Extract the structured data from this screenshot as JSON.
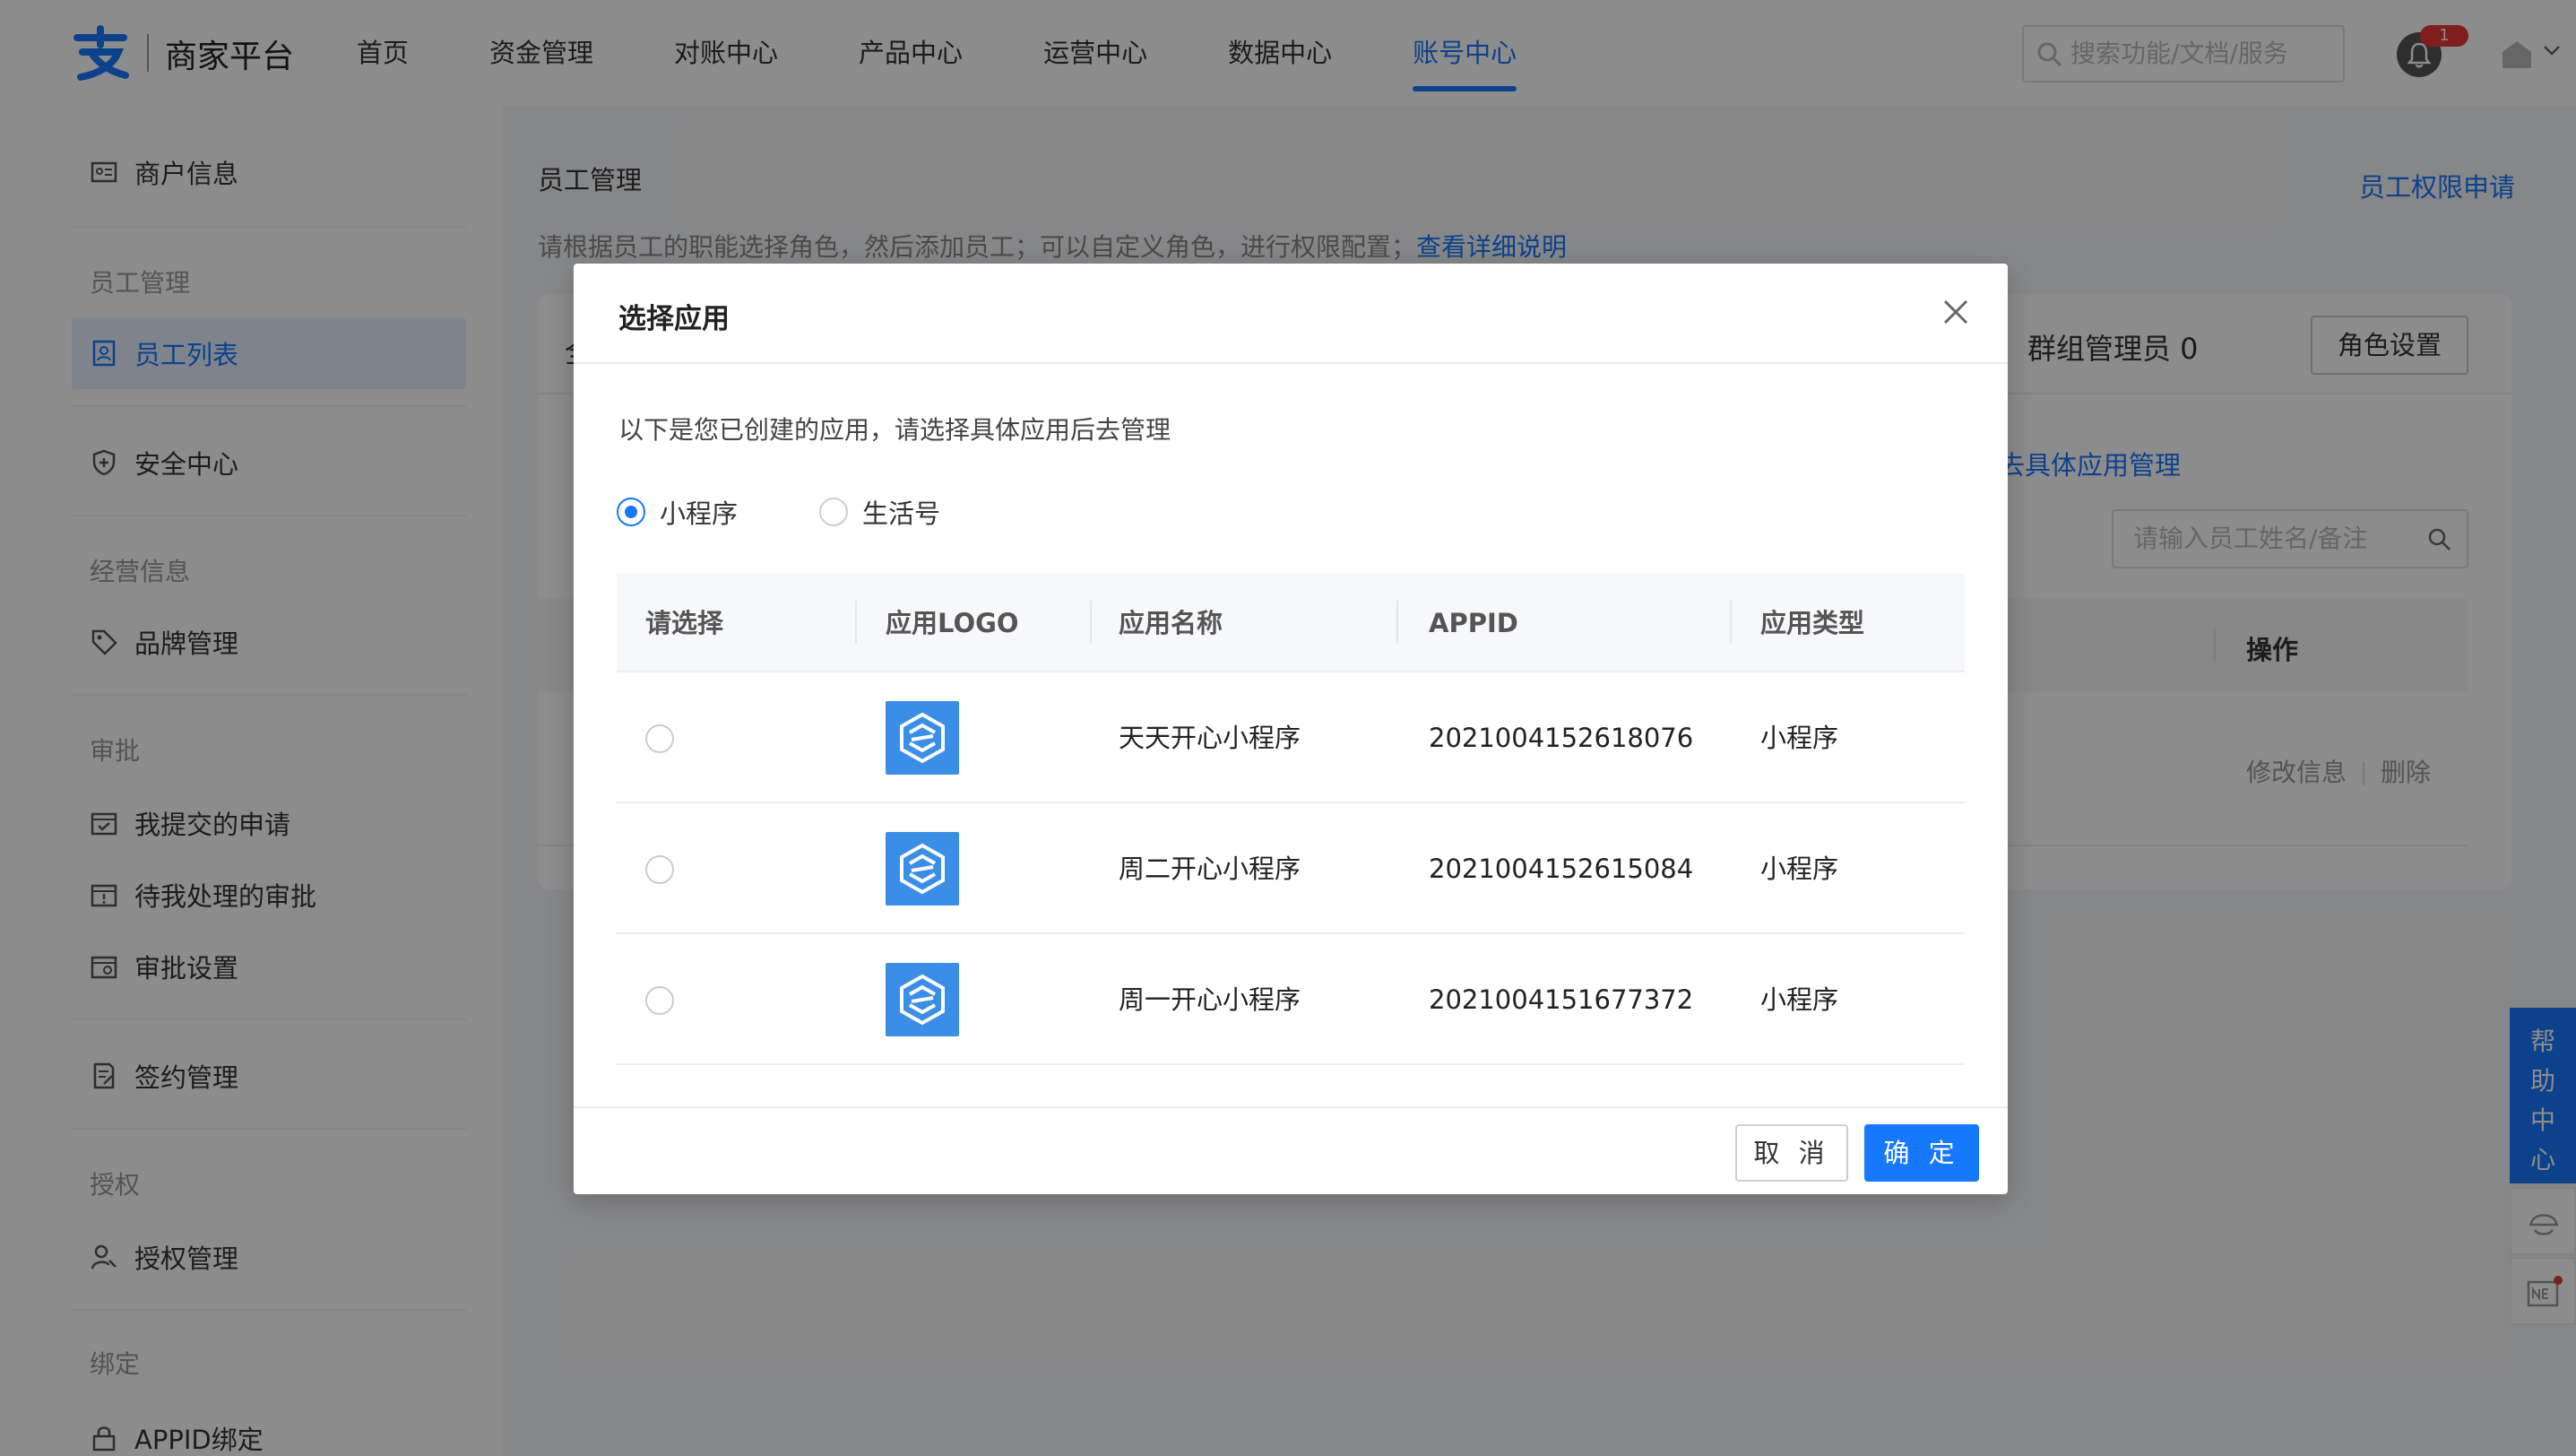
{
  "header": {
    "brand": "商家平台",
    "nav": [
      {
        "label": "首页",
        "active": false
      },
      {
        "label": "资金管理",
        "active": false
      },
      {
        "label": "对账中心",
        "active": false
      },
      {
        "label": "产品中心",
        "active": false
      },
      {
        "label": "运营中心",
        "active": false
      },
      {
        "label": "数据中心",
        "active": false
      },
      {
        "label": "账号中心",
        "active": true
      }
    ],
    "search_placeholder": "搜索功能/文档/服务",
    "notification_count": "1"
  },
  "sidebar": {
    "merchant_info": "商户信息",
    "group_staff": "员工管理",
    "staff_list": "员工列表",
    "security_center": "安全中心",
    "group_business": "经营信息",
    "brand_mgmt": "品牌管理",
    "group_approval": "审批",
    "my_requests": "我提交的申请",
    "pending_approvals": "待我处理的审批",
    "approval_settings": "审批设置",
    "contract_mgmt": "签约管理",
    "group_auth": "授权",
    "auth_mgmt": "授权管理",
    "group_bind": "绑定",
    "appid_bind": "APPID绑定"
  },
  "main": {
    "title": "员工管理",
    "apply_link": "员工权限申请",
    "desc": "请根据员工的职能选择角色，然后添加员工；可以自定义角色，进行权限配置；",
    "desc_link": "查看详细说明",
    "card_first_char": "全",
    "group_admin": "群组管理员  0",
    "role_settings": "角色设置",
    "manage_link": "去具体应用管理",
    "emp_search_placeholder": "请输入员工姓名/备注",
    "op_header": "操作",
    "row_edit": "修改信息",
    "row_delete": "删除"
  },
  "help": {
    "label": [
      "帮",
      "助",
      "中",
      "心"
    ]
  },
  "modal": {
    "title": "选择应用",
    "desc": "以下是您已创建的应用，请选择具体应用后去管理",
    "radio_options": [
      {
        "label": "小程序",
        "checked": true
      },
      {
        "label": "生活号",
        "checked": false
      }
    ],
    "columns": [
      "请选择",
      "应用LOGO",
      "应用名称",
      "APPID",
      "应用类型"
    ],
    "rows": [
      {
        "name": "天天开心小程序",
        "appid": "2021004152618076",
        "type": "小程序"
      },
      {
        "name": "周二开心小程序",
        "appid": "2021004152615084",
        "type": "小程序"
      },
      {
        "name": "周一开心小程序",
        "appid": "2021004151677372",
        "type": "小程序"
      }
    ],
    "cancel": "取 消",
    "ok": "确 定"
  },
  "colors": {
    "accent": "#1677ff",
    "app_logo": "#3a8ee6",
    "badge": "#e53935"
  }
}
